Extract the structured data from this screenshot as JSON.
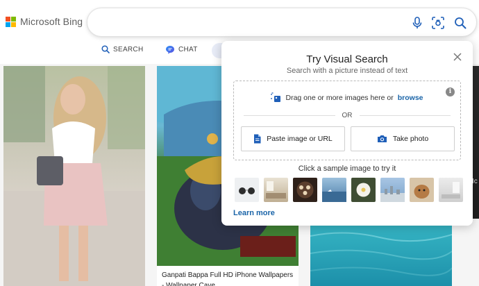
{
  "brand": {
    "name": "Microsoft Bing",
    "logo_colors": [
      "#f25022",
      "#7fba00",
      "#00a4ef",
      "#ffb900"
    ]
  },
  "search": {
    "value": "",
    "placeholder": "",
    "icons": [
      "microphone-icon",
      "visual-search-icon",
      "search-icon"
    ]
  },
  "nav": {
    "items": [
      {
        "label": "SEARCH",
        "icon": "search-icon"
      },
      {
        "label": "CHAT",
        "icon": "chat-icon"
      }
    ]
  },
  "results": {
    "caption": "Ganpati Bappa Full HD iPhone Wallpapers - Wallpaper Cave",
    "edge_text": "Ic"
  },
  "visual_search": {
    "title": "Try Visual Search",
    "subtitle": "Search with a picture instead of text",
    "drag_text": "Drag one or more images here or",
    "browse_label": "browse",
    "or_label": "OR",
    "paste_label": "Paste image or URL",
    "photo_label": "Take photo",
    "sample_label": "Click a sample image to try it",
    "learn_more": "Learn more",
    "sample_thumbs": [
      {
        "name": "sunglasses",
        "color": "#e9ecef"
      },
      {
        "name": "living-room",
        "color": "#c9bfa9"
      },
      {
        "name": "food-plate",
        "color": "#3c2a22"
      },
      {
        "name": "sailboat",
        "color": "#5d88ad"
      },
      {
        "name": "white-flower",
        "color": "#44533a"
      },
      {
        "name": "city-skyline",
        "color": "#7ea4c7"
      },
      {
        "name": "dog",
        "color": "#b98653"
      },
      {
        "name": "room-interior",
        "color": "#dcdcdc"
      }
    ]
  },
  "colors": {
    "accent": "#1a64a8",
    "icon_blue": "#1f5fb8"
  }
}
